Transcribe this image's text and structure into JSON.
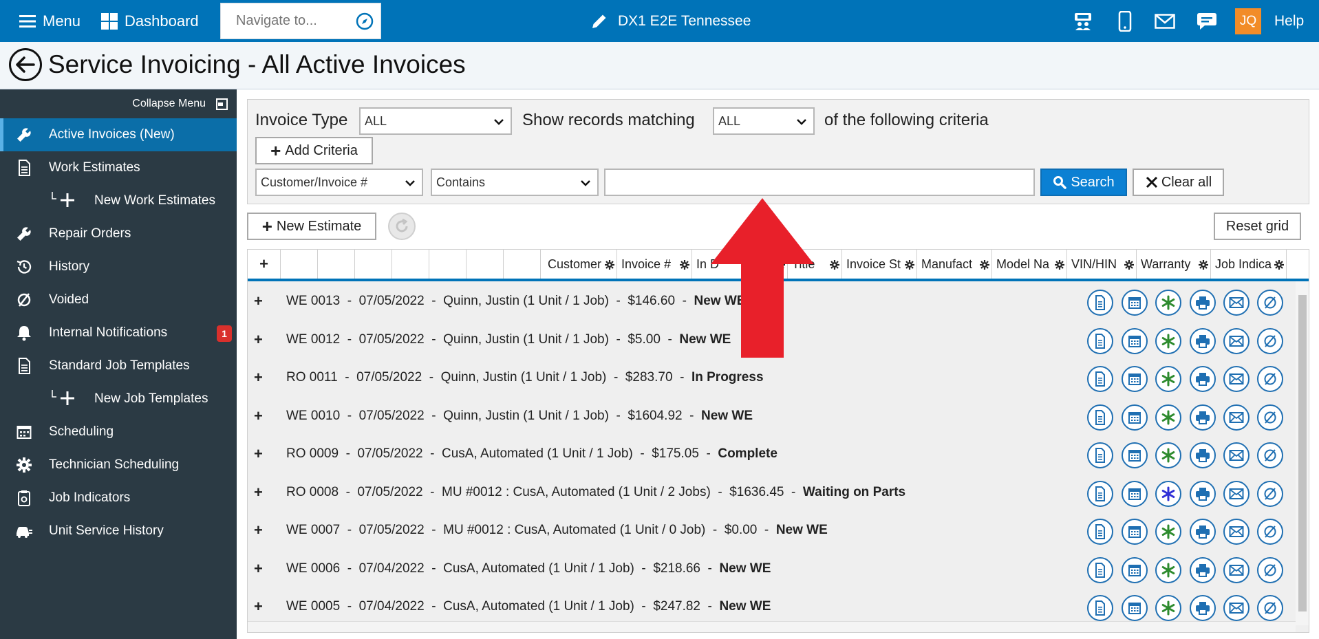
{
  "topbar": {
    "menu_label": "Menu",
    "dashboard_label": "Dashboard",
    "navigate_placeholder": "Navigate to...",
    "dealer_title": "DX1 E2E Tennessee",
    "avatar_initials": "JQ",
    "help_label": "Help",
    "bar_color": "#0073b8"
  },
  "page": {
    "title": "Service Invoicing - All Active Invoices"
  },
  "sidebar": {
    "collapse_label": "Collapse Menu",
    "items": [
      {
        "label": "Active Invoices (New)",
        "icon": "wrench-icon",
        "active": true
      },
      {
        "label": "Work Estimates",
        "icon": "document-icon"
      },
      {
        "label": "New Work Estimates",
        "icon": "plus-icon",
        "sub": true
      },
      {
        "label": "Repair Orders",
        "icon": "wrench-icon"
      },
      {
        "label": "History",
        "icon": "history-icon"
      },
      {
        "label": "Voided",
        "icon": "void-icon"
      },
      {
        "label": "Internal Notifications",
        "icon": "bell-icon",
        "badge": "1"
      },
      {
        "label": "Standard Job Templates",
        "icon": "document-icon"
      },
      {
        "label": "New Job Templates",
        "icon": "plus-icon",
        "sub": true
      },
      {
        "label": "Scheduling",
        "icon": "calendar-icon"
      },
      {
        "label": "Technician Scheduling",
        "icon": "gear-icon"
      },
      {
        "label": "Job Indicators",
        "icon": "clipboard-icon"
      },
      {
        "label": "Unit Service History",
        "icon": "vehicle-icon"
      }
    ]
  },
  "filter": {
    "invoice_type_label": "Invoice Type",
    "invoice_type_value": "ALL",
    "show_records_label": "Show records matching",
    "match_value": "ALL",
    "criteria_suffix": "of the following criteria",
    "add_criteria_label": "Add Criteria",
    "field_value": "Customer/Invoice #",
    "operator_value": "Contains",
    "search_value": "",
    "search_label": "Search",
    "clear_label": "Clear all"
  },
  "toolbar": {
    "new_estimate_label": "New Estimate",
    "reset_grid_label": "Reset grid"
  },
  "grid": {
    "columns": [
      "Customer",
      "Invoice #",
      "In D",
      "Title",
      "Invoice St",
      "Manufact",
      "Model Na",
      "VIN/HIN",
      "Warranty",
      "Job Indica"
    ],
    "rows": [
      {
        "text": "WE 0013  -  07/05/2022  -  Quinn, Justin (1 Unit / 1 Job)  -  $146.60  -  ",
        "status": "New WE",
        "warranty": "green"
      },
      {
        "text": "WE 0012  -  07/05/2022  -  Quinn, Justin (1 Unit / 1 Job)  -  $5.00  -  ",
        "status": "New WE",
        "warranty": "green"
      },
      {
        "text": "RO 0011  -  07/05/2022  -  Quinn, Justin (1 Unit / 1 Job)  -  $283.70  -  ",
        "status": "In Progress",
        "warranty": "green"
      },
      {
        "text": "WE 0010  -  07/05/2022  -  Quinn, Justin (1 Unit / 1 Job)  -  $1604.92  -  ",
        "status": "New WE",
        "warranty": "green"
      },
      {
        "text": "RO 0009  -  07/05/2022  -  CusA, Automated (1 Unit / 1 Job)  -  $175.05  -  ",
        "status": "Complete",
        "warranty": "green"
      },
      {
        "text": "RO 0008  -  07/05/2022  -  MU #0012 : CusA, Automated (1 Unit / 2 Jobs)  -  $1636.45  -  ",
        "status": "Waiting on Parts",
        "warranty": "blue"
      },
      {
        "text": "WE 0007  -  07/05/2022  -  MU #0012 : CusA, Automated (1 Unit / 0 Job)  -  $0.00  -  ",
        "status": "New WE",
        "warranty": "green"
      },
      {
        "text": "WE 0006  -  07/04/2022  -  CusA, Automated (1 Unit / 1 Job)  -  $218.66  -  ",
        "status": "New WE",
        "warranty": "green"
      },
      {
        "text": "WE 0005  -  07/04/2022  -  CusA, Automated (1 Unit / 1 Job)  -  $247.82  -  ",
        "status": "New WE",
        "warranty": "green"
      }
    ],
    "row_actions": [
      "document-icon",
      "calendar-icon",
      "warranty-icon",
      "print-icon",
      "email-icon",
      "void-icon"
    ]
  },
  "annotation": {
    "arrow_color": "#e8202a",
    "arrow_icon": "red-up-arrow-icon"
  }
}
